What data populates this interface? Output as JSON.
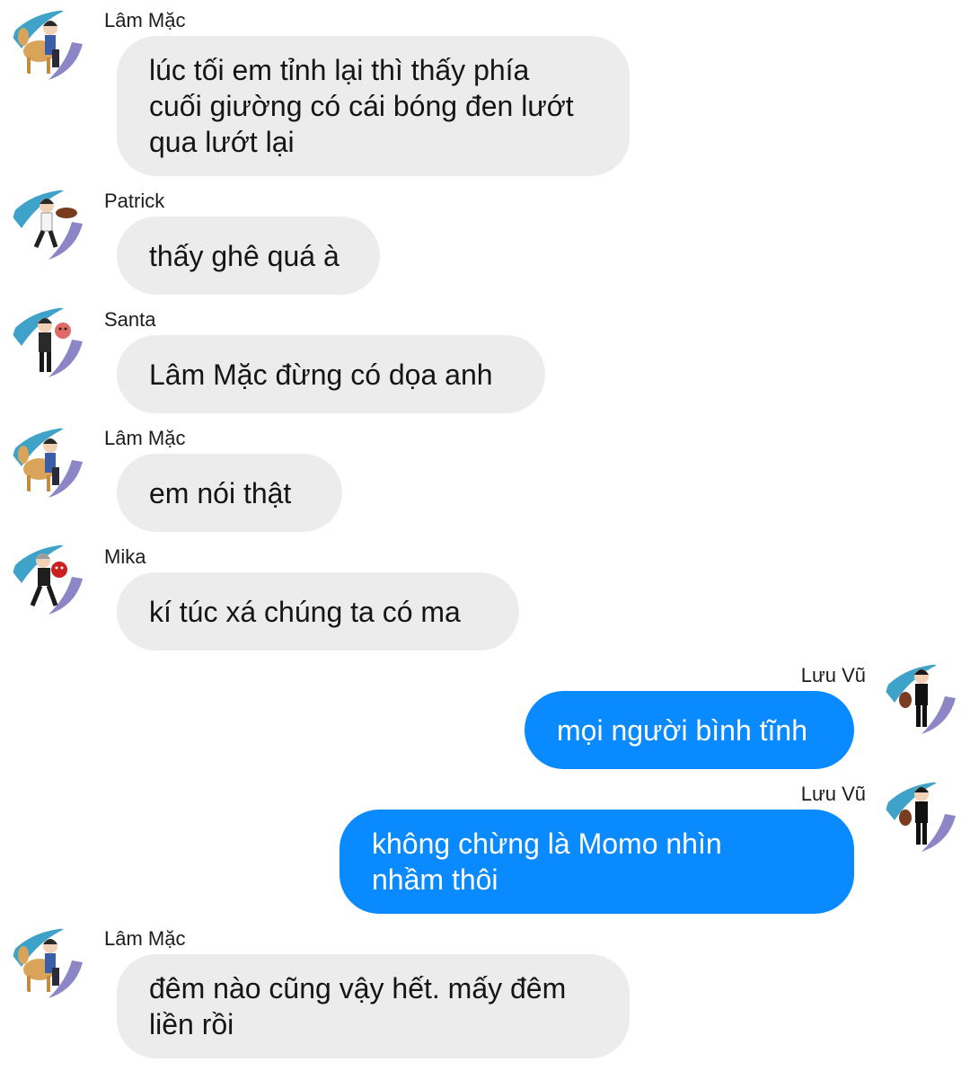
{
  "conversation": {
    "messages": [
      {
        "sender": "Lâm Mặc",
        "avatar": "camel-rider-avatar",
        "lines": [
          "lúc tối em tỉnh lại thì thấy phía",
          "cuối giường có cái bóng đen lướt",
          "qua lướt lại"
        ]
      },
      {
        "sender": "Patrick",
        "avatar": "chef-avatar",
        "lines": [
          "thấy ghê quá à"
        ]
      },
      {
        "sender": "Santa",
        "avatar": "suit-mask-avatar",
        "lines": [
          "Lâm Mặc đừng có dọa anh"
        ]
      },
      {
        "sender": "Lâm Mặc",
        "avatar": "camel-rider-avatar",
        "lines": [
          "em nói thật"
        ]
      },
      {
        "sender": "Mika",
        "avatar": "red-mask-avatar",
        "lines": [
          "kí túc xá chúng ta có ma"
        ]
      },
      {
        "sender": "Lưu Vũ",
        "avatar": "black-suit-avatar",
        "lines": [
          "mọi người bình tĩnh"
        ]
      },
      {
        "sender": "Lưu Vũ",
        "avatar": "black-suit-avatar",
        "lines": [
          "không chừng là Momo nhìn",
          "nhầm thôi"
        ]
      },
      {
        "sender": "Lâm Mặc",
        "avatar": "camel-rider-avatar",
        "lines": [
          "đêm nào cũng vậy hết. mấy đêm",
          "liền rồi"
        ]
      }
    ]
  },
  "colors": {
    "incoming_bubble": "#ececec",
    "outgoing_bubble": "#0a8aff",
    "avatar_swoosh_blue": "#3fa3c9",
    "avatar_swoosh_purple": "#8d86c6"
  }
}
